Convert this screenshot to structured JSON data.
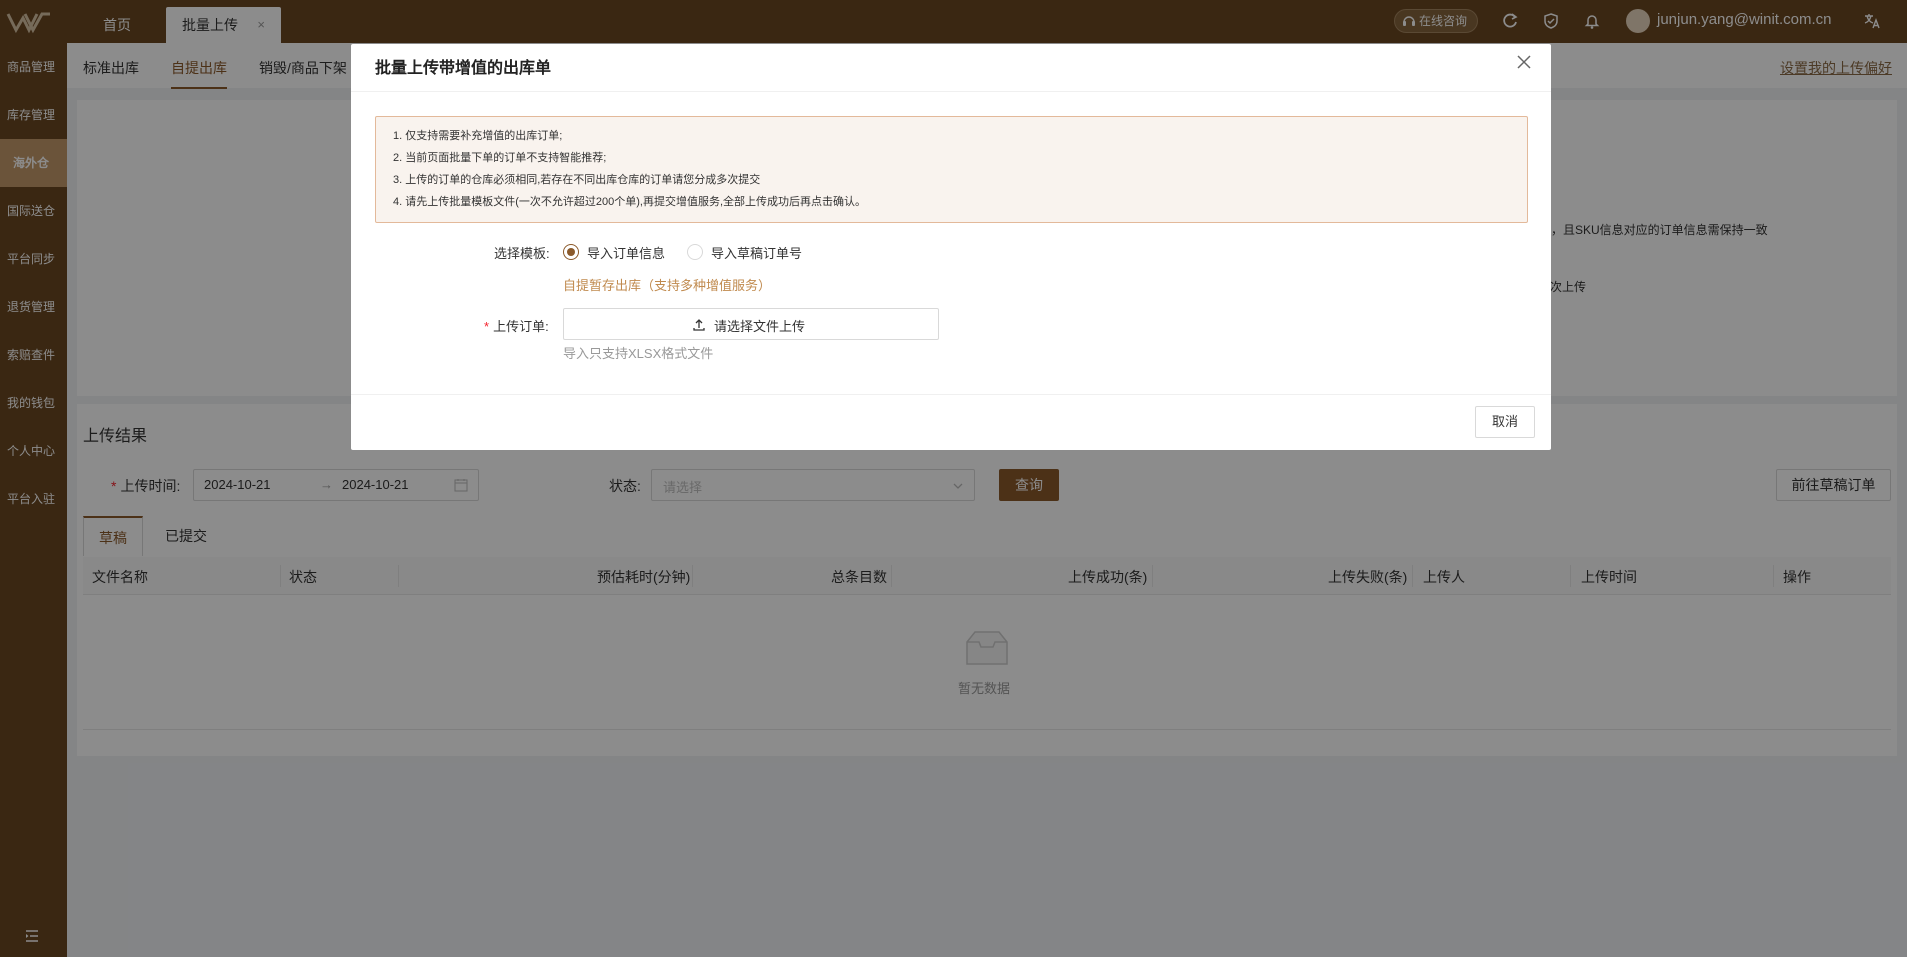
{
  "header": {
    "tabs": [
      {
        "label": "首页"
      },
      {
        "label": "批量上传",
        "close": "×"
      }
    ],
    "consult_label": "在线咨询",
    "user_email": "junjun.yang@winit.com.cn"
  },
  "sidebar": {
    "items": [
      {
        "label": "商品管理"
      },
      {
        "label": "库存管理"
      },
      {
        "label": "海外仓"
      },
      {
        "label": "国际送仓"
      },
      {
        "label": "平台同步"
      },
      {
        "label": "退货管理"
      },
      {
        "label": "索赔查件"
      },
      {
        "label": "我的钱包"
      },
      {
        "label": "个人中心"
      },
      {
        "label": "平台入驻"
      }
    ]
  },
  "subnav": {
    "tabs": [
      "标准出库",
      "自提出库",
      "销毁/商品下架"
    ],
    "pref_link": "设置我的上传偏好"
  },
  "background": {
    "frag1": "号，且SKU信息对应的订单信息需保持一致",
    "frag2": "次上传"
  },
  "results": {
    "title": "上传结果",
    "upload_time_label": "上传时间:",
    "date_start": "2024-10-21",
    "date_arrow": "→",
    "date_end": "2024-10-21",
    "status_label": "状态:",
    "status_placeholder": "请选择",
    "query_label": "查询",
    "goto_draft_label": "前往草稿订单",
    "tabs": [
      "草稿",
      "已提交"
    ],
    "columns": [
      "文件名称",
      "状态",
      "预估耗时(分钟)",
      "总条目数",
      "上传成功(条)",
      "上传失败(条)",
      "上传人",
      "上传时间",
      "操作"
    ],
    "empty_text": "暂无数据"
  },
  "modal": {
    "title": "批量上传带增值的出库单",
    "notices": [
      "1. 仅支持需要补充增值的出库订单;",
      "2. 当前页面批量下单的订单不支持智能推荐;",
      "3. 上传的订单的仓库必须相同,若存在不同出库仓库的订单请您分成多次提交",
      "4. 请先上传批量模板文件(一次不允许超过200个单),再提交增值服务,全部上传成功后再点击确认。"
    ],
    "template_label": "选择模板:",
    "radio_options": [
      "导入订单信息",
      "导入草稿订单号"
    ],
    "template_link": "自提暂存出库（支持多种增值服务）",
    "upload_label": "上传订单:",
    "upload_button": "请选择文件上传",
    "upload_hint": "导入只支持XLSX格式文件",
    "cancel_label": "取消"
  },
  "colors": {
    "brand": "#6b4721",
    "accent": "#8b5a2b",
    "sidebar_active": "#c49a6b"
  }
}
